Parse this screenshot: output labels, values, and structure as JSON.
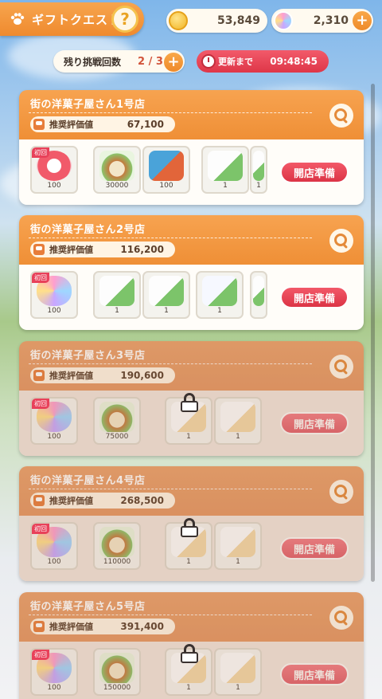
{
  "header": {
    "title": "ギフトクエスト",
    "help_label": "?",
    "coins": "53,849",
    "gems": "2,310",
    "plus_label": "+"
  },
  "challenge": {
    "label": "残り挑戦回数",
    "count": "2 / 3"
  },
  "refresh": {
    "label": "更新まで",
    "time": "09:48:45"
  },
  "colors": {
    "accent_orange": "#ef8f36",
    "button_red": "#dc3446"
  },
  "cards": [
    {
      "name": "街の洋菓子屋さん1号店",
      "rating_label": "推奨評価値",
      "rating": "67,100",
      "open_label": "開店準備",
      "locked": false,
      "badge": "初回",
      "items": [
        "100",
        "30000",
        "100",
        "1",
        "1"
      ]
    },
    {
      "name": "街の洋菓子屋さん2号店",
      "rating_label": "推奨評価値",
      "rating": "116,200",
      "open_label": "開店準備",
      "locked": false,
      "badge": "初回",
      "items": [
        "100",
        "1",
        "1",
        "1",
        ""
      ]
    },
    {
      "name": "街の洋菓子屋さん3号店",
      "rating_label": "推奨評価値",
      "rating": "190,600",
      "open_label": "開店準備",
      "locked": true,
      "badge": "初回",
      "items": [
        "100",
        "75000",
        "1",
        "1"
      ]
    },
    {
      "name": "街の洋菓子屋さん4号店",
      "rating_label": "推奨評価値",
      "rating": "268,500",
      "open_label": "開店準備",
      "locked": true,
      "badge": "初回",
      "items": [
        "100",
        "110000",
        "1",
        "1"
      ]
    },
    {
      "name": "街の洋菓子屋さん5号店",
      "rating_label": "推奨評価値",
      "rating": "391,400",
      "open_label": "開店準備",
      "locked": true,
      "badge": "初回",
      "items": [
        "100",
        "150000",
        "1",
        "1"
      ]
    }
  ]
}
